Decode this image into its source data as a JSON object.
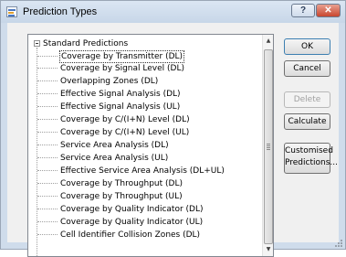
{
  "window": {
    "title": "Prediction Types",
    "help_label": "?",
    "close_label": "✕"
  },
  "tree": {
    "root_label": "Standard Predictions",
    "items": [
      "Coverage by Transmitter (DL)",
      "Coverage by Signal Level (DL)",
      "Overlapping Zones (DL)",
      "Effective Signal Analysis (DL)",
      "Effective Signal Analysis (UL)",
      "Coverage by C/(I+N) Level (DL)",
      "Coverage by C/(I+N) Level (UL)",
      "Service Area Analysis (DL)",
      "Service Area Analysis (UL)",
      "Effective Service Area Analysis (DL+UL)",
      "Coverage by Throughput (DL)",
      "Coverage by Throughput (UL)",
      "Coverage by Quality Indicator (DL)",
      "Coverage by Quality Indicator (UL)",
      "Cell Identifier Collision Zones (DL)"
    ],
    "selected_index": 0
  },
  "buttons": {
    "ok": "OK",
    "cancel": "Cancel",
    "delete": "Delete",
    "calculate": "Calculate",
    "customised_line1": "Customised",
    "customised_line2": "Predictions..."
  },
  "scrollbar": {
    "up_icon": "▲",
    "down_icon": "▼"
  }
}
